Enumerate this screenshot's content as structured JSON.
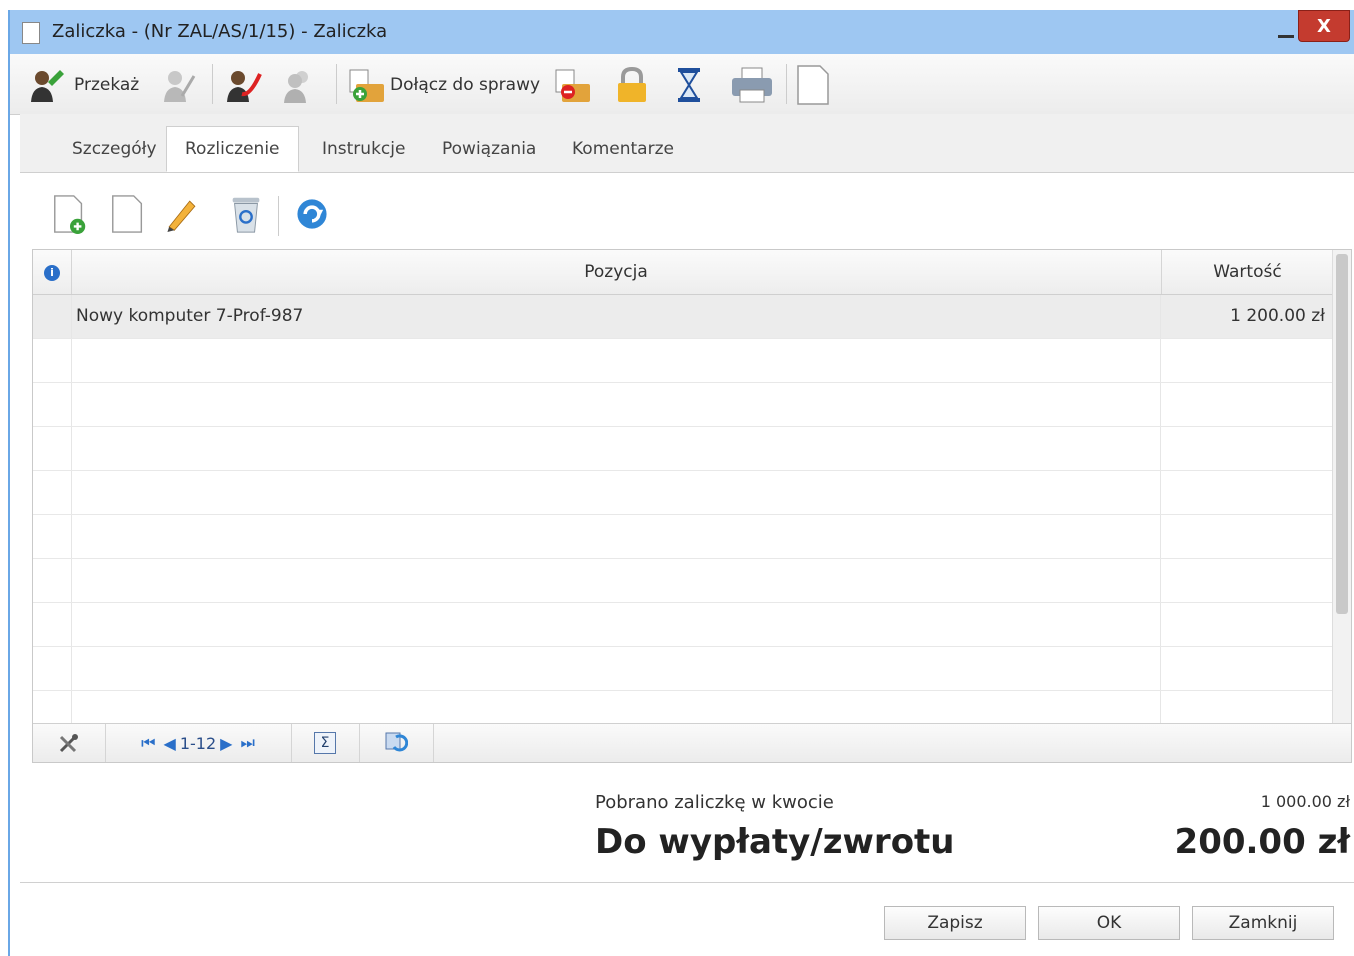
{
  "window": {
    "title": "Zaliczka - (Nr ZAL/AS/1/15) - Zaliczka",
    "close_glyph": "X",
    "minimize_icon": "minimize-icon"
  },
  "toolbar": {
    "forward_label": "Przekaż",
    "attach_label": "Dołącz do sprawy",
    "icons": [
      "forward-user-icon",
      "user-disabled-icon",
      "user-accept-icon",
      "users-disabled-icon",
      "attach-folder-icon",
      "detach-folder-icon",
      "lock-icon",
      "hourglass-icon",
      "printer-icon",
      "document-icon"
    ]
  },
  "tabs": [
    {
      "label": "Szczegóły",
      "active": false
    },
    {
      "label": "Rozliczenie",
      "active": true
    },
    {
      "label": "Instrukcje",
      "active": false
    },
    {
      "label": "Powiązania",
      "active": false
    },
    {
      "label": "Komentarze",
      "active": false
    }
  ],
  "subtoolbar": {
    "icons": [
      "add-document-icon",
      "document-icon",
      "edit-pencil-icon",
      "recycle-bin-icon",
      "refresh-icon"
    ]
  },
  "grid": {
    "info_glyph": "i",
    "headers": {
      "position": "Pozycja",
      "value": "Wartość"
    },
    "rows": [
      {
        "position": "Nowy komputer 7-Prof-987",
        "value": "1 200.00 zł"
      }
    ],
    "pager": {
      "first_glyph": "⏮",
      "prev_glyph": "◀",
      "range": "1-12",
      "next_glyph": "▶",
      "last_glyph": "⏭",
      "sum_glyph": "Σ"
    }
  },
  "summary": {
    "advance_label": "Pobrano zaliczkę w kwocie",
    "advance_value": "1 000.00 zł",
    "payout_label": "Do wypłaty/zwrotu",
    "payout_value": "200.00 zł"
  },
  "buttons": {
    "save": "Zapisz",
    "ok": "OK",
    "close": "Zamknij"
  }
}
